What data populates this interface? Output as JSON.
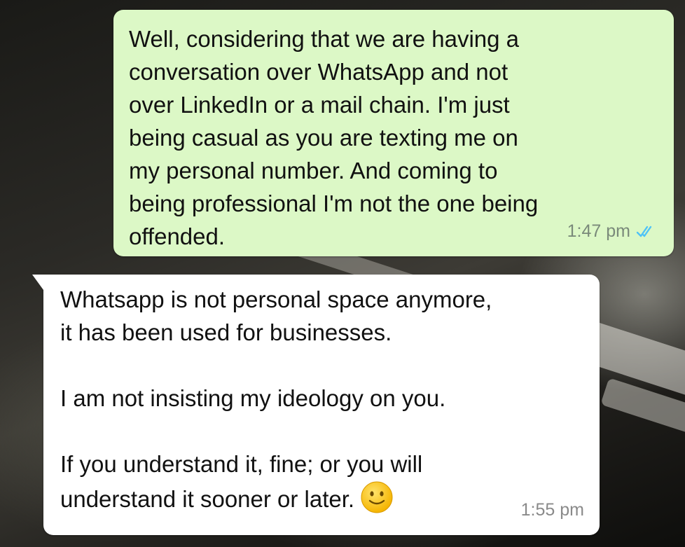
{
  "chat": {
    "messages": [
      {
        "direction": "outgoing",
        "text": "Well,  considering that we are having a\nconversation over WhatsApp and not\nover LinkedIn or a mail chain.  I'm just\nbeing casual as you are texting me on\nmy personal number. And coming to\nbeing professional I'm not the one being\noffended.",
        "time": "1:47 pm",
        "status": "read",
        "status_icon": "double-check-icon",
        "status_color": "#4fc3f7"
      },
      {
        "direction": "incoming",
        "text": "Whatsapp is not personal space anymore,\nit has been used for businesses.\n\nI am not insisting my ideology on you.\n\nIf you understand it, fine; or you will\nunderstand it sooner or later.",
        "emoji": "slightly-smiling-face-icon",
        "time": "1:55 pm"
      }
    ]
  },
  "colors": {
    "outgoing_bubble": "#dcf8c6",
    "incoming_bubble": "#ffffff",
    "timestamp": "#7a8a7a"
  }
}
